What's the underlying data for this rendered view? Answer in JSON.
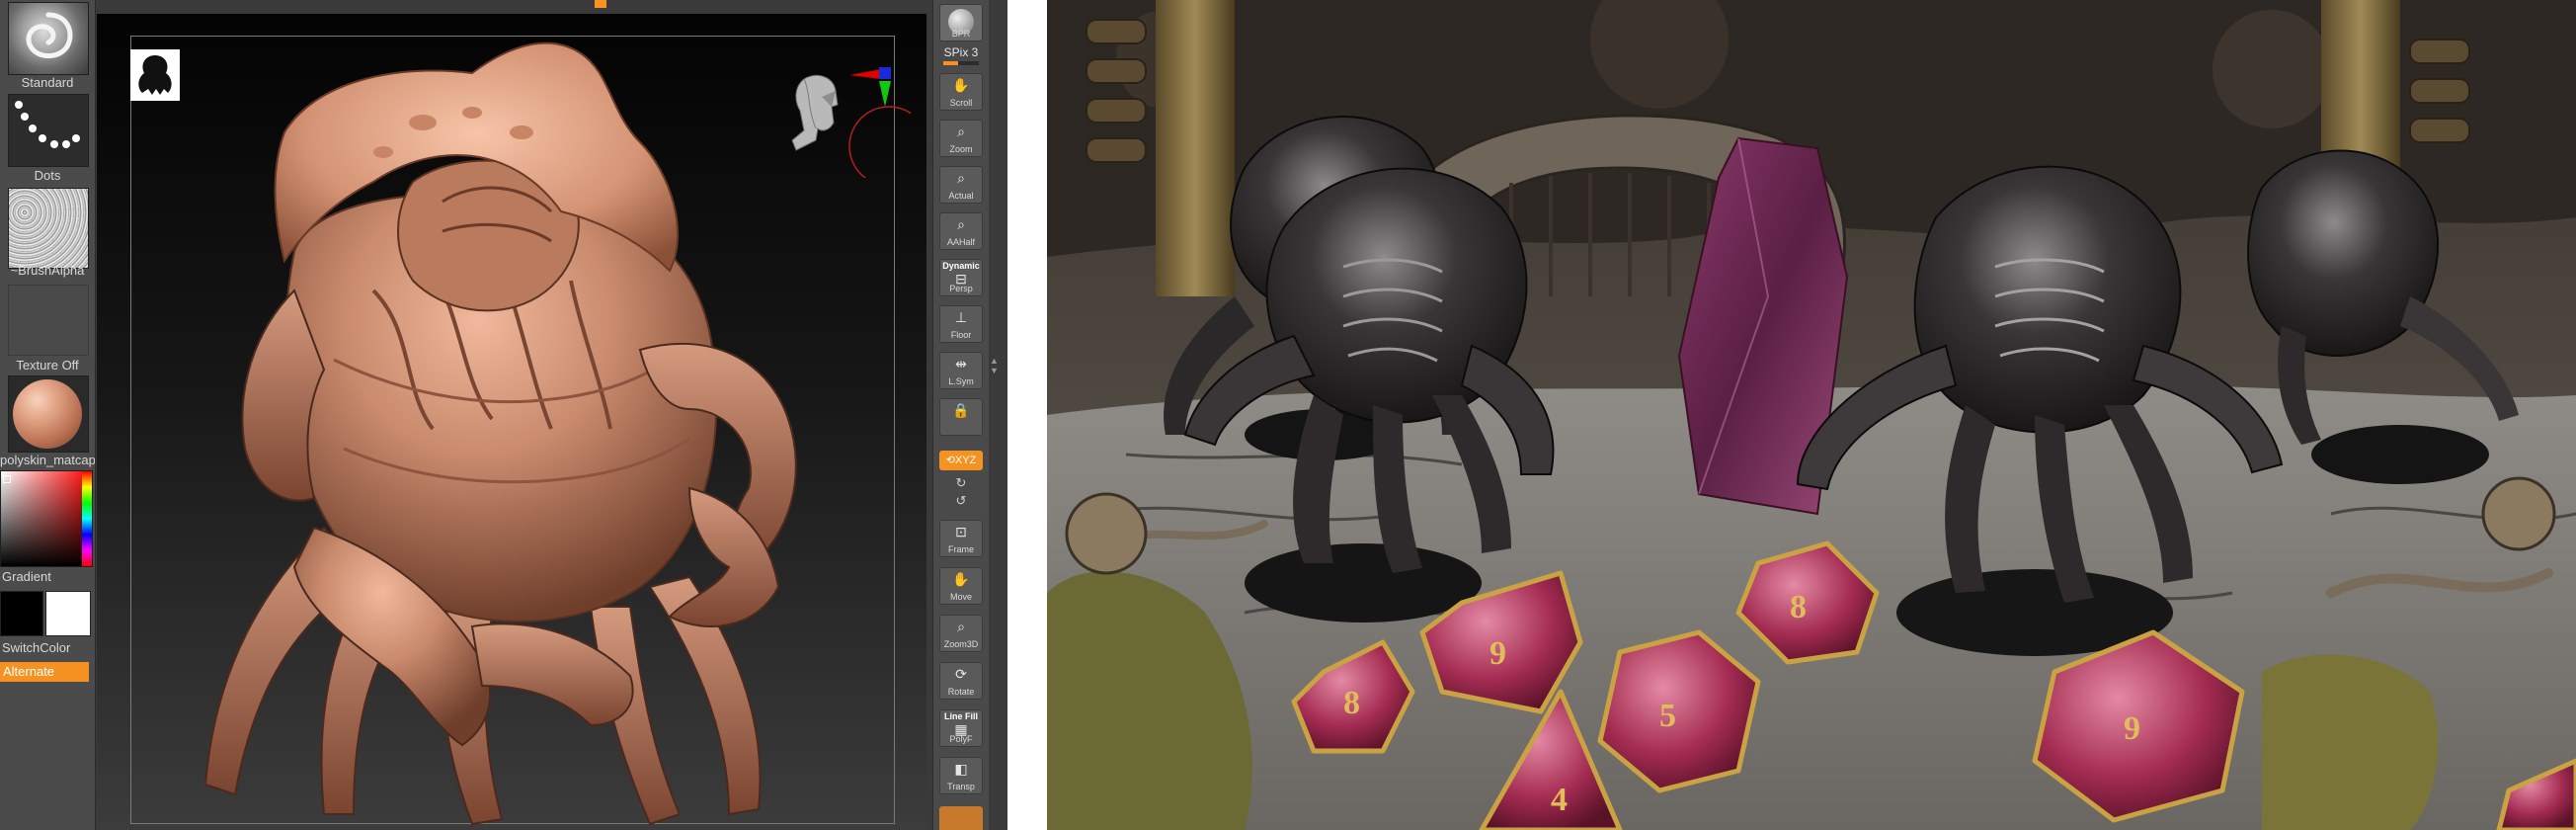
{
  "left_tray": {
    "brush_label": "Standard",
    "stroke_label": "Dots",
    "alpha_label": "~BrushAlpha",
    "texture_label": "Texture Off",
    "material_label": "polyskin_matcap",
    "gradient_label": "Gradient",
    "switch_color_label": "SwitchColor",
    "alternate_label": "Alternate"
  },
  "right_shelf": {
    "bpr_label": "BPR",
    "spix_label": "SPix 3",
    "spix_value": 3,
    "buttons": [
      {
        "label": "Scroll",
        "icon": "hand-icon"
      },
      {
        "label": "Zoom",
        "icon": "magnify-icon"
      },
      {
        "label": "Actual",
        "icon": "magnify-icon"
      },
      {
        "label": "AAHalf",
        "icon": "magnify-icon"
      },
      {
        "label": "Persp",
        "top_label": "Dynamic",
        "icon": "perspective-icon"
      },
      {
        "label": "Floor",
        "icon": "floor-icon"
      },
      {
        "label": "L.Sym",
        "icon": "symmetry-icon"
      },
      {
        "label": "",
        "icon": "lock-icon"
      }
    ],
    "xyz_label": "XYZ",
    "buttons_lower": [
      {
        "label": "Frame",
        "icon": "frame-icon"
      },
      {
        "label": "Move",
        "icon": "move-hand-icon"
      },
      {
        "label": "Zoom3D",
        "icon": "zoom3d-icon"
      },
      {
        "label": "Rotate",
        "icon": "rotate-icon"
      },
      {
        "label": "PolyF",
        "top_label": "Line Fill",
        "icon": "polyframe-icon"
      },
      {
        "label": "Transp",
        "icon": "transparency-icon"
      }
    ]
  },
  "colors": {
    "accent": "#f59322",
    "panel": "#4a4a4a",
    "skin": "#c98a6d"
  }
}
